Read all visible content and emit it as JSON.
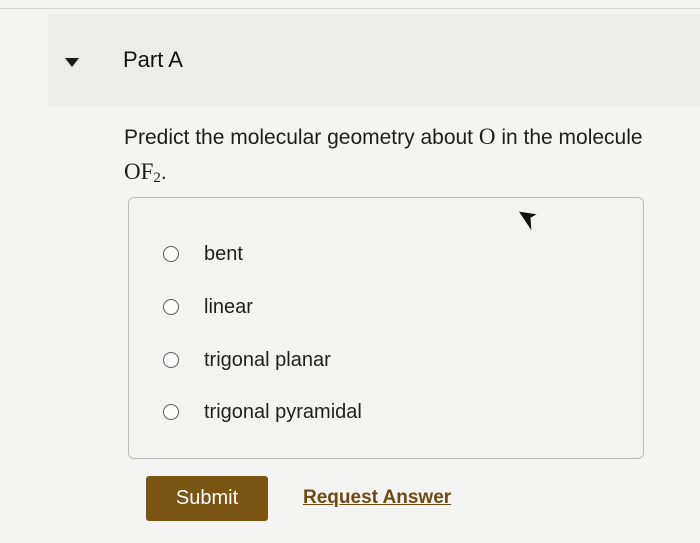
{
  "part": {
    "title": "Part A"
  },
  "question": {
    "text_before": "Predict the molecular geometry about ",
    "central_atom": "O",
    "text_middle": " in the molecule ",
    "formula_base": "OF",
    "formula_sub": "2",
    "text_after": "."
  },
  "options": [
    {
      "label": "bent",
      "selected": false
    },
    {
      "label": "linear",
      "selected": false
    },
    {
      "label": "trigonal planar",
      "selected": false
    },
    {
      "label": "trigonal pyramidal",
      "selected": false
    }
  ],
  "actions": {
    "submit_label": "Submit",
    "request_label": "Request Answer"
  },
  "colors": {
    "submit_bg": "#7a5413",
    "link": "#6e4a12"
  },
  "icons": {
    "collapse": "caret-down-icon",
    "cursor": "mouse-pointer-icon"
  }
}
